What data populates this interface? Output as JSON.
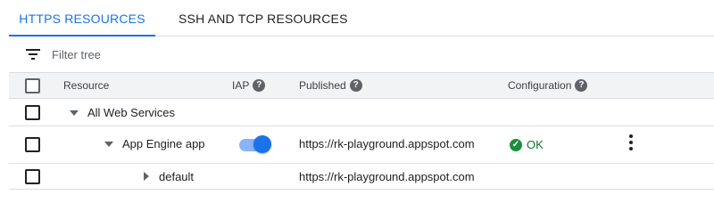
{
  "tabs": [
    {
      "label": "HTTPS RESOURCES",
      "active": true
    },
    {
      "label": "SSH AND TCP RESOURCES",
      "active": false
    }
  ],
  "filter": {
    "placeholder": "Filter tree",
    "value": "",
    "icon": "filter-list-icon"
  },
  "table": {
    "columns": [
      {
        "label": "Resource",
        "help": false
      },
      {
        "label": "IAP",
        "help": true
      },
      {
        "label": "Published",
        "help": true
      },
      {
        "label": "Configuration",
        "help": true
      }
    ],
    "help_glyph": "?",
    "rows": [
      {
        "resource": "All Web Services",
        "expanded": true,
        "iap": null,
        "published": "",
        "configuration": ""
      },
      {
        "resource": "App Engine app",
        "expanded": true,
        "iap": true,
        "published": "https://rk-playground.appspot.com",
        "configuration": "OK"
      },
      {
        "resource": "default",
        "expanded": false,
        "iap": null,
        "published": "https://rk-playground.appspot.com",
        "configuration": ""
      }
    ]
  },
  "colors": {
    "accent": "#1a73e8",
    "ok": "#1e8e3e",
    "toggle_track": "#8ab4f8"
  }
}
